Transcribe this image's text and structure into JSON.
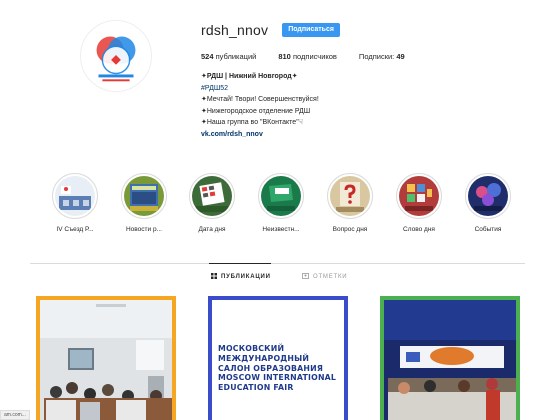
{
  "profile": {
    "username": "rdsh_nnov",
    "follow_label": "Подписаться",
    "stats": {
      "posts_count": "524",
      "posts_label": "публикаций",
      "followers_count": "810",
      "followers_label": "подписчиков",
      "following_label": "Подписки:",
      "following_count": "49"
    },
    "bio": {
      "title": "✦РДШ | Нижний Новгород✦",
      "hashtag": "#РДШ52",
      "line1": "✦Мечтай! Твори! Совершенствуйся!",
      "line2": "✦Нижегородское отделение РДШ",
      "line3": "✦Наша группа во \"ВКонтакте\"☟",
      "link": "vk.com/rdsh_nnov"
    }
  },
  "stories": [
    {
      "label": "IV Съезд Р..."
    },
    {
      "label": "Новости р..."
    },
    {
      "label": "Дата дня"
    },
    {
      "label": "Неизвестн..."
    },
    {
      "label": "Вопрос дня"
    },
    {
      "label": "Слово дня"
    },
    {
      "label": "События"
    }
  ],
  "tabs": {
    "posts": "ПУБЛИКАЦИИ",
    "tagged": "ОТМЕТКИ"
  },
  "posts": {
    "expo_lines": [
      "МОСКОВСКИЙ",
      "МЕЖДУНАРОДНЫЙ",
      "САЛОН ОБРАЗОВАНИЯ",
      "MOSCOW INTERNATIONAL",
      "EDUCATION FAIR"
    ]
  },
  "status_url": "am.com...",
  "colors": {
    "follow_button": "#3897f0",
    "link": "#003569",
    "post1_border": "#f5a623",
    "post2_border": "#3b4cca",
    "post3_border": "#4caf50"
  }
}
